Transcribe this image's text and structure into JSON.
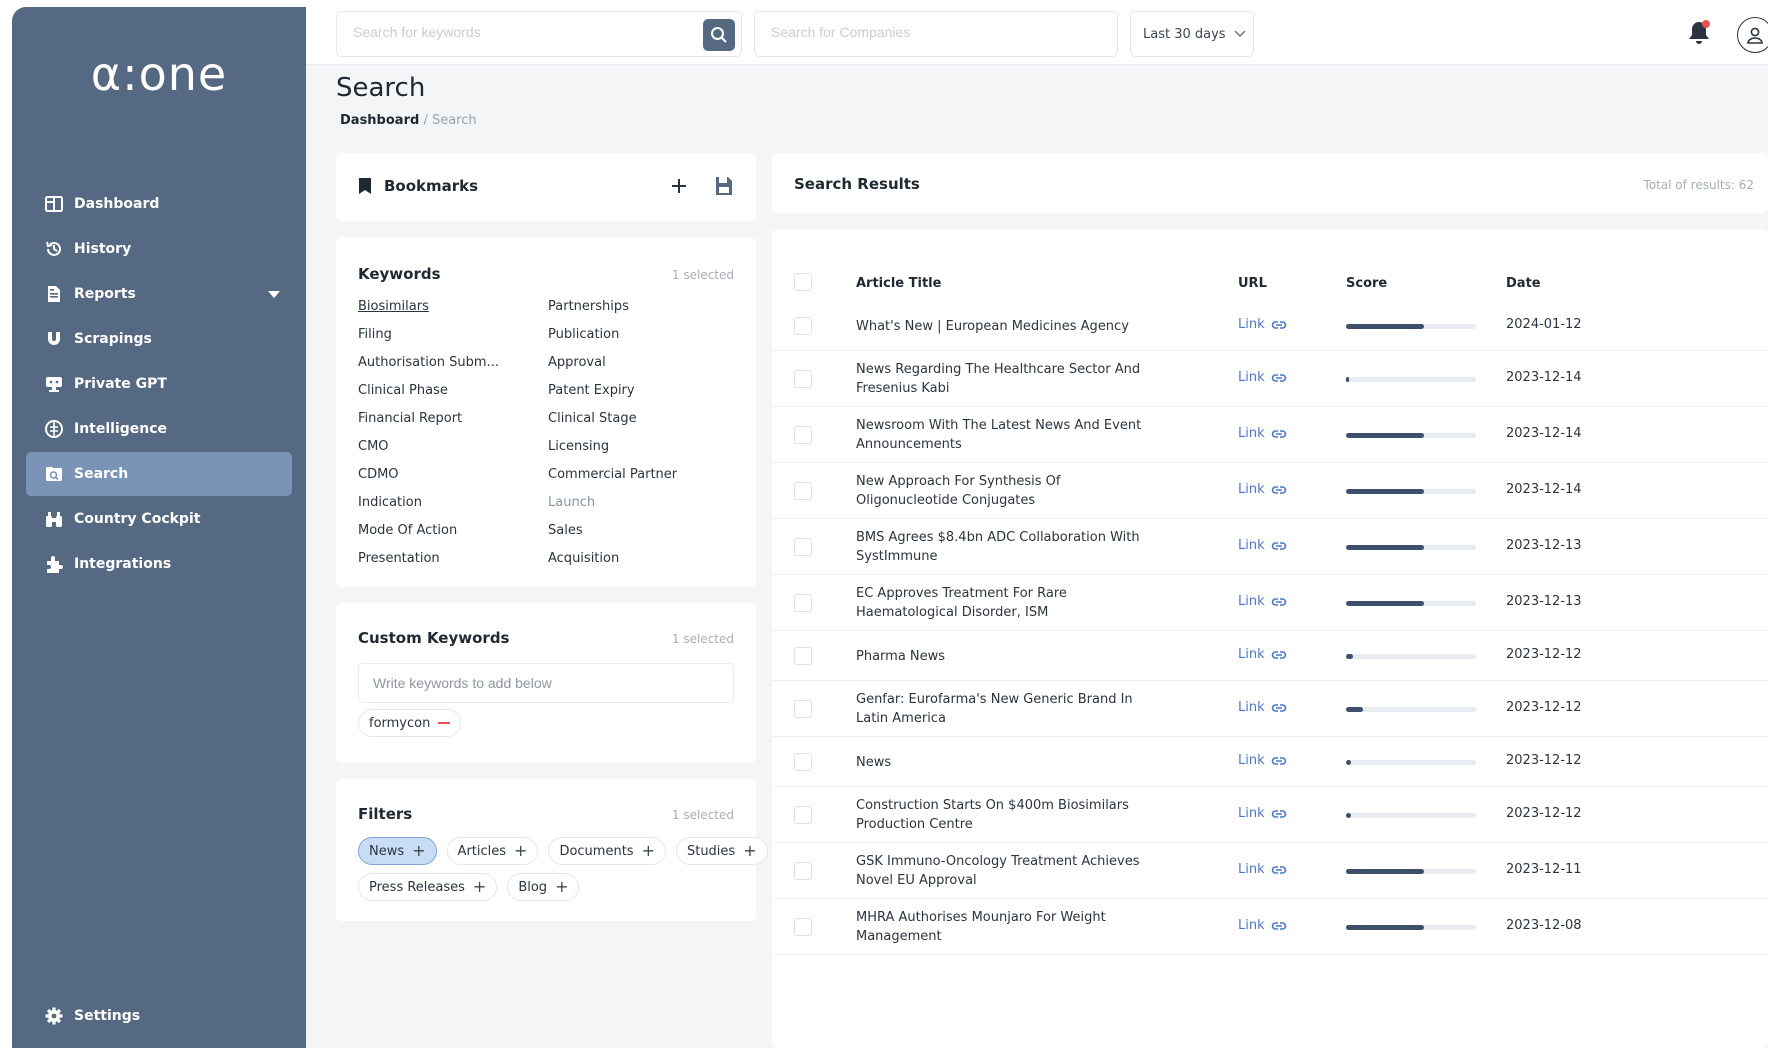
{
  "app": {
    "logo": "α:one"
  },
  "sidebar": {
    "items": [
      {
        "label": "Dashboard",
        "icon": "dashboard-icon"
      },
      {
        "label": "History",
        "icon": "history-icon"
      },
      {
        "label": "Reports",
        "icon": "reports-icon"
      },
      {
        "label": "Scrapings",
        "icon": "scrapings-icon"
      },
      {
        "label": "Private GPT",
        "icon": "private-gpt-icon"
      },
      {
        "label": "Intelligence",
        "icon": "intelligence-icon"
      },
      {
        "label": "Search",
        "icon": "search-icon",
        "active": true
      },
      {
        "label": "Country Cockpit",
        "icon": "country-cockpit-icon"
      },
      {
        "label": "Integrations",
        "icon": "integrations-icon"
      }
    ],
    "settings_label": "Settings"
  },
  "topbar": {
    "keyword_placeholder": "Search for keywords",
    "company_placeholder": "Search for Companies",
    "date_range": "Last 30 days"
  },
  "header": {
    "title": "Search",
    "breadcrumb_home": "Dashboard",
    "breadcrumb_sep": "/",
    "breadcrumb_current": "Search"
  },
  "bookmarks": {
    "title": "Bookmarks"
  },
  "keywords": {
    "title": "Keywords",
    "selected": "1 selected",
    "items": [
      "Biosimilars",
      "Partnerships",
      "Filing",
      "Publication",
      "Authorisation Subm...",
      "Approval",
      "Clinical Phase",
      "Patent Expiry",
      "Financial Report",
      "Clinical Stage",
      "CMO",
      "Licensing",
      "CDMO",
      "Commercial Partner",
      "Indication",
      "Launch",
      "Mode Of Action",
      "Sales",
      "Presentation",
      "Acquisition"
    ]
  },
  "custom_keywords": {
    "title": "Custom Keywords",
    "selected": "1 selected",
    "placeholder": "Write keywords to add below",
    "chips": [
      "formycon"
    ]
  },
  "filters": {
    "title": "Filters",
    "selected": "1 selected",
    "row1": [
      "News",
      "Articles",
      "Documents",
      "Studies"
    ],
    "row2": [
      "Press Releases",
      "Blog"
    ]
  },
  "results": {
    "title": "Search Results",
    "total": "Total of results: 62",
    "columns": {
      "title": "Article Title",
      "url": "URL",
      "score": "Score",
      "date": "Date"
    },
    "link_label": "Link",
    "rows": [
      {
        "title": "What's New | European Medicines Agency",
        "score": 0.6,
        "date": "2024-01-12"
      },
      {
        "title": "News Regarding The Healthcare Sector And Fresenius Kabi",
        "score": 0.02,
        "date": "2023-12-14"
      },
      {
        "title": "Newsroom With The Latest News And Event Announcements",
        "score": 0.6,
        "date": "2023-12-14"
      },
      {
        "title": "New Approach For Synthesis Of Oligonucleotide Conjugates",
        "score": 0.6,
        "date": "2023-12-14"
      },
      {
        "title": "BMS Agrees $8.4bn ADC Collaboration With SystImmune",
        "score": 0.6,
        "date": "2023-12-13"
      },
      {
        "title": "EC Approves Treatment For Rare Haematological Disorder, ISM",
        "score": 0.6,
        "date": "2023-12-13"
      },
      {
        "title": "Pharma News",
        "score": 0.05,
        "date": "2023-12-12"
      },
      {
        "title": "Genfar: Eurofarma's New Generic Brand In Latin America",
        "score": 0.13,
        "date": "2023-12-12"
      },
      {
        "title": "News",
        "score": 0.04,
        "date": "2023-12-12"
      },
      {
        "title": "Construction Starts On $400m Biosimilars Production Centre",
        "score": 0.04,
        "date": "2023-12-12"
      },
      {
        "title": "GSK Immuno-Oncology Treatment Achieves Novel EU Approval",
        "score": 0.6,
        "date": "2023-12-11"
      },
      {
        "title": "MHRA Authorises Mounjaro For Weight Management",
        "score": 0.6,
        "date": "2023-12-08"
      }
    ]
  }
}
